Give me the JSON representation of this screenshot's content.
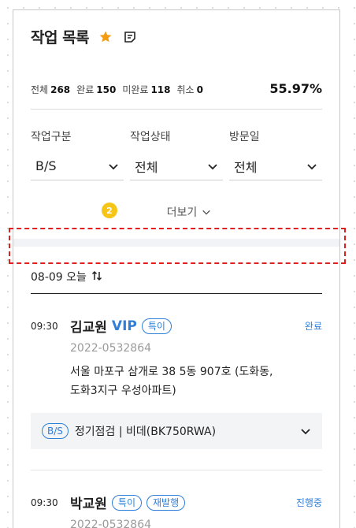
{
  "header": {
    "title": "작업 목록"
  },
  "stats": {
    "total_label": "전체",
    "total": "268",
    "done_label": "완료",
    "done": "150",
    "undone_label": "미완료",
    "undone": "118",
    "cancel_label": "취소",
    "cancel": "0",
    "rate": "55.97%"
  },
  "filters": [
    {
      "label": "작업구분",
      "value": "B/S"
    },
    {
      "label": "작업상태",
      "value": "전체"
    },
    {
      "label": "방문일",
      "value": "전체"
    }
  ],
  "more": {
    "badge": "2",
    "label": "더보기"
  },
  "date_group": {
    "label": "08-09 오늘"
  },
  "items": [
    {
      "time": "09:30",
      "name": "김교원",
      "vip": "VIP",
      "tags": [
        "특이"
      ],
      "status": "완료",
      "code": "2022-0532864",
      "address": "서울 마포구 삼개로 38 5동 907호 (도화동, 도화3지구 우성아파트)",
      "service_tag": "B/S",
      "service": "정기점검 | 비데(BK750RWA)"
    },
    {
      "time": "09:30",
      "name": "박교원",
      "tags": [
        "특이",
        "재발행"
      ],
      "status": "진행중",
      "code": "2022-0532864"
    }
  ],
  "colors": {
    "accent": "#2f7fd8",
    "star": "#f39c12",
    "badge": "#f5c518",
    "highlight": "#e02020"
  }
}
